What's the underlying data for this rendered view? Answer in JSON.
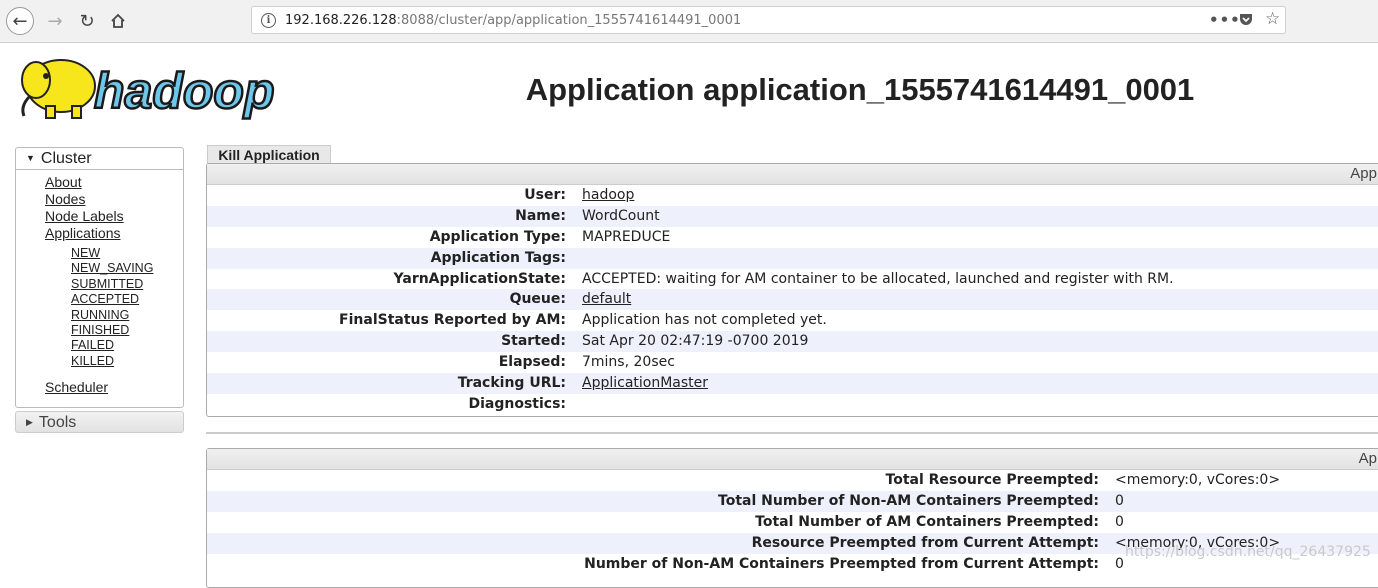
{
  "browser": {
    "url_host": "192.168.226.128",
    "url_rest": ":8088/cluster/app/application_1555741614491_0001"
  },
  "logo": {
    "text": "hadoop"
  },
  "page": {
    "title": "Application application_1555741614491_0001"
  },
  "sidebar": {
    "cluster_label": "Cluster",
    "links": [
      "About",
      "Nodes",
      "Node Labels",
      "Applications"
    ],
    "states": [
      "NEW",
      "NEW_SAVING",
      "SUBMITTED",
      "ACCEPTED",
      "RUNNING",
      "FINISHED",
      "FAILED",
      "KILLED"
    ],
    "scheduler": "Scheduler",
    "tools_label": "Tools"
  },
  "actions": {
    "kill": "Kill Application"
  },
  "overview": {
    "header": "App",
    "rows": [
      {
        "label": "User:",
        "value": "hadoop",
        "link": true
      },
      {
        "label": "Name:",
        "value": "WordCount",
        "link": false
      },
      {
        "label": "Application Type:",
        "value": "MAPREDUCE",
        "link": false
      },
      {
        "label": "Application Tags:",
        "value": "",
        "link": false
      },
      {
        "label": "YarnApplicationState:",
        "value": "ACCEPTED: waiting for AM container to be allocated, launched and register with RM.",
        "link": false
      },
      {
        "label": "Queue:",
        "value": "default",
        "link": true
      },
      {
        "label": "FinalStatus Reported by AM:",
        "value": "Application has not completed yet.",
        "link": false
      },
      {
        "label": "Started:",
        "value": "Sat Apr 20 02:47:19 -0700 2019",
        "link": false
      },
      {
        "label": "Elapsed:",
        "value": "7mins, 20sec",
        "link": false
      },
      {
        "label": "Tracking URL:",
        "value": "ApplicationMaster",
        "link": true
      },
      {
        "label": "Diagnostics:",
        "value": "",
        "link": false
      }
    ]
  },
  "metrics": {
    "header": "Ap",
    "rows": [
      {
        "label": "Total Resource Preempted:",
        "value": "<memory:0, vCores:0>"
      },
      {
        "label": "Total Number of Non-AM Containers Preempted:",
        "value": "0"
      },
      {
        "label": "Total Number of AM Containers Preempted:",
        "value": "0"
      },
      {
        "label": "Resource Preempted from Current Attempt:",
        "value": "<memory:0, vCores:0>"
      },
      {
        "label": "Number of Non-AM Containers Preempted from Current Attempt:",
        "value": "0"
      }
    ]
  },
  "watermark": "https://blog.csdn.net/qq_26437925"
}
